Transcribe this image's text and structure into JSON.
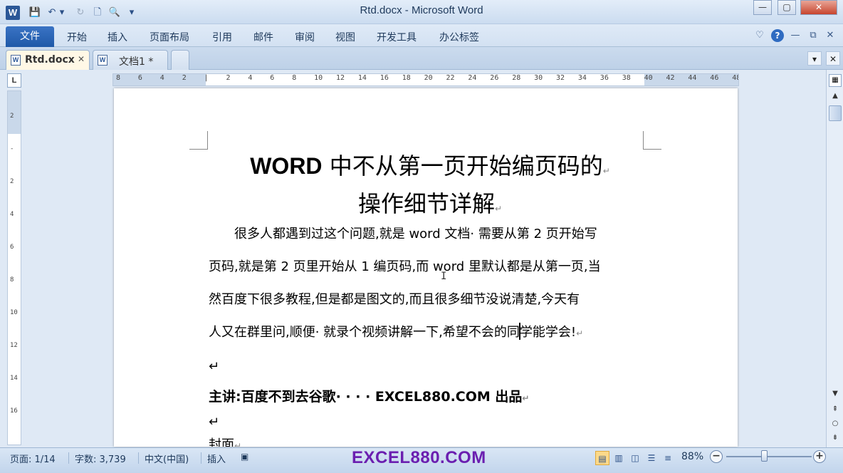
{
  "window": {
    "title": "Rtd.docx - Microsoft Word",
    "app_icon": "W"
  },
  "qat": {
    "save": "💾",
    "undo": "↶",
    "dropdown": "▾",
    "redo": "↻",
    "new": "🗋",
    "preview": "🔍",
    "customize": "▾"
  },
  "window_controls": {
    "minimize": "—",
    "maximize": "▢",
    "close": "✕"
  },
  "ribbon": {
    "file_tab": "文件",
    "tabs": [
      "开始",
      "插入",
      "页面布局",
      "引用",
      "邮件",
      "审阅",
      "视图",
      "开发工具",
      "办公标签"
    ],
    "right_icons": {
      "collapse": "♡",
      "help": "?",
      "min": "—",
      "restore": "⧉",
      "close": "✕"
    }
  },
  "doc_tabs": [
    {
      "label": "Rtd.docx",
      "close": "✕",
      "active": true
    },
    {
      "label": "文档1 *",
      "close": ""
    }
  ],
  "doc_tab_controls": {
    "dropdown": "▾",
    "close": "✕"
  },
  "ruler": {
    "corner": "L",
    "h_ticks": [
      "8",
      "6",
      "4",
      "2",
      "",
      "2",
      "4",
      "6",
      "8",
      "10",
      "12",
      "14",
      "16",
      "18",
      "20",
      "22",
      "24",
      "26",
      "28",
      "30",
      "32",
      "34",
      "36",
      "38",
      "40",
      "42",
      "44",
      "46",
      "48"
    ],
    "v_ticks": [
      "2",
      "",
      "2",
      "4",
      "6",
      "8",
      "10",
      "12",
      "14",
      "16"
    ]
  },
  "document": {
    "title_line1_latin": "WORD",
    "title_line1_rest": " 中不从第一页开始编页码的",
    "title_line2": "操作细节详解",
    "para_marker": "↵",
    "body_lines": [
      "　　很多人都遇到过这个问题,就是 word 文档· 需要从第 2 页开始写",
      "页码,就是第 2 页里开始从 1 编页码,而 word 里默认都是从第一页,当",
      "然百度下很多教程,但是都是图文的,而且很多细节没说清楚,今天有"
    ],
    "line4_before_cursor": "人又在群里问,顺便· 就录个视频讲解一下,希望不会的同",
    "line4_after_cursor": "学能学会!",
    "speaker_line": "主讲:百度不到去谷歌· · · · EXCEL880.COM 出品",
    "cover_line": "封面"
  },
  "status": {
    "page": "页面: 1/14",
    "words": "字数: 3,739",
    "language": "中文(中国)",
    "insert_mode": "插入",
    "watermark": "EXCEL880.COM",
    "zoom": "88%",
    "zoom_fraction": 0.44
  }
}
